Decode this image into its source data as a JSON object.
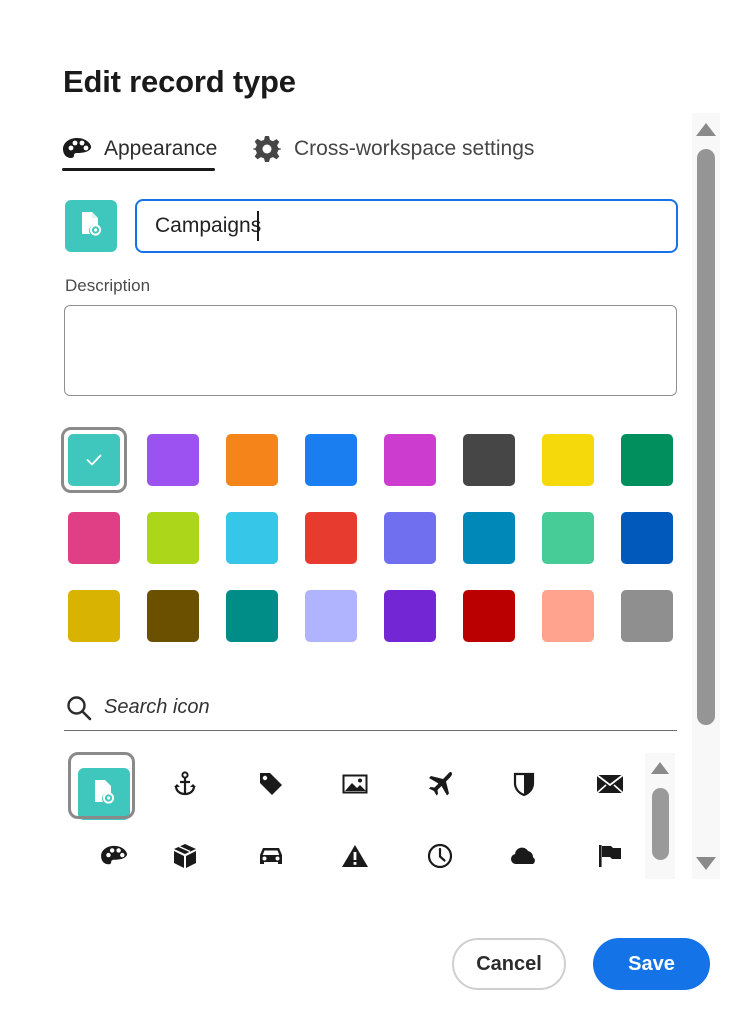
{
  "dialog": {
    "title": "Edit record type"
  },
  "tabs": [
    {
      "label": "Appearance",
      "icon": "palette-icon",
      "active": true
    },
    {
      "label": "Cross-workspace settings",
      "icon": "gear-icon",
      "active": false
    }
  ],
  "name_field": {
    "value": "Campaigns",
    "icon": "document-gear-icon"
  },
  "description": {
    "label": "Description",
    "value": ""
  },
  "colors": {
    "selected": "#3fc7bd",
    "rows": [
      [
        "#3fc7bd",
        "#9c52f1",
        "#f5841b",
        "#1a7ef0",
        "#cc3ccf",
        "#464646",
        "#f5d90a",
        "#008f5d"
      ],
      [
        "#e13f85",
        "#acd619",
        "#35c6e8",
        "#e63b2e",
        "#6f6ff0",
        "#0089b8",
        "#48cc97",
        "#0059bb"
      ],
      [
        "#d8b302",
        "#6b5000",
        "#008c87",
        "#b0b3fd",
        "#7326d3",
        "#ba0000",
        "#ffa38e",
        "#8f8f8f"
      ]
    ]
  },
  "icon_search": {
    "placeholder": "Search icon"
  },
  "icons": {
    "selected": "document-gear-icon",
    "row1": [
      "document-gear-icon",
      "anchor-icon",
      "tag-icon",
      "image-icon",
      "airplane-icon",
      "shield-icon",
      "mail-icon"
    ],
    "row2": [
      "palette-icon",
      "box-icon",
      "car-icon",
      "warning-icon",
      "clock-icon",
      "cloud-icon",
      "flag-icon"
    ]
  },
  "footer": {
    "cancel_label": "Cancel",
    "save_label": "Save"
  }
}
